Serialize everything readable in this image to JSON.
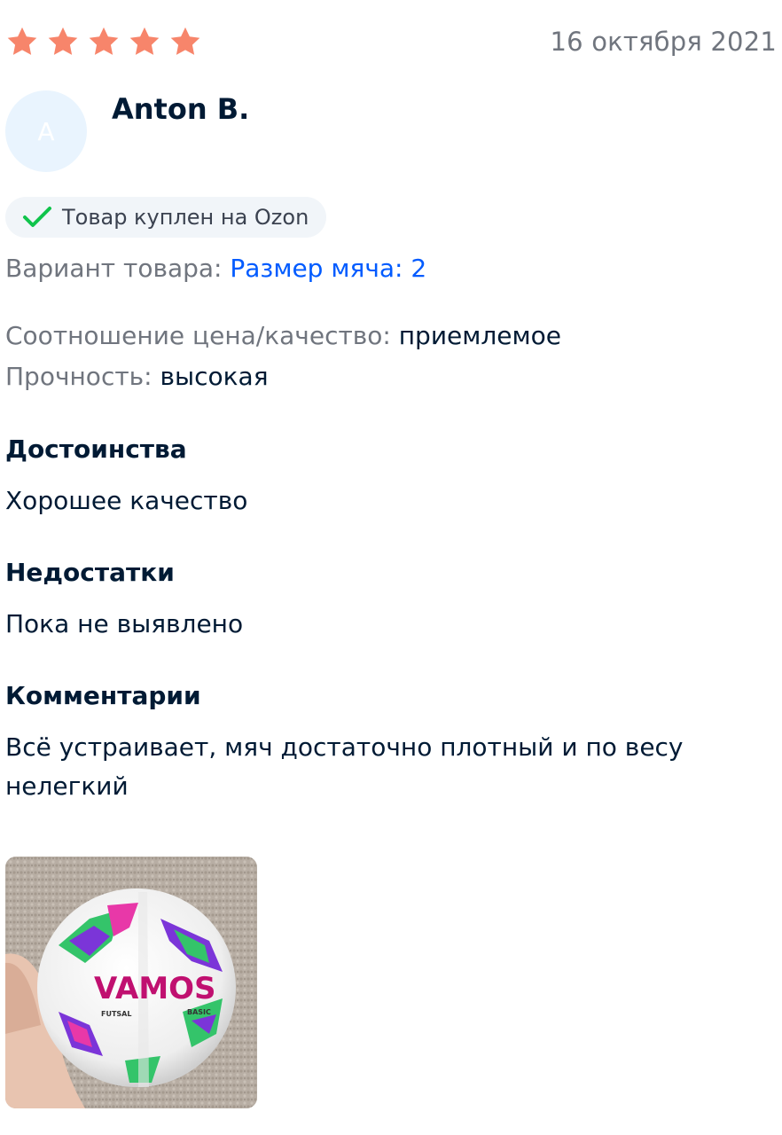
{
  "review": {
    "rating": 5,
    "rating_max": 5,
    "star_color": "#f7856b",
    "date": "16 октября 2021",
    "author": {
      "name": "Anton B.",
      "initial": "A"
    },
    "verified_badge": {
      "icon": "checkmark-icon",
      "label": "Товар куплен на Ozon"
    },
    "variant": {
      "label": "Вариант товара:",
      "value": "Размер мяча: 2"
    },
    "attributes": [
      {
        "label": "Соотношение цена/качество:",
        "value": "приемлемое"
      },
      {
        "label": "Прочность:",
        "value": "высокая"
      }
    ],
    "pros": {
      "title": "Достоинства",
      "text": "Хорошее качество"
    },
    "cons": {
      "title": "Недостатки",
      "text": "Пока не выявлено"
    },
    "comment": {
      "title": "Комментарии",
      "text_line1": "Всё устраивает, мяч достаточно плотный и по весу",
      "text_line2": "нелегкий"
    },
    "photo": {
      "brand_text": "VAMOS",
      "sub_left": "FUTSAL",
      "sub_right": "BASIC"
    }
  },
  "colors": {
    "link": "#005bff",
    "muted": "#70757e",
    "text": "#001a34",
    "check": "#10c44c",
    "avatar_bg": "#e9f4fe"
  }
}
